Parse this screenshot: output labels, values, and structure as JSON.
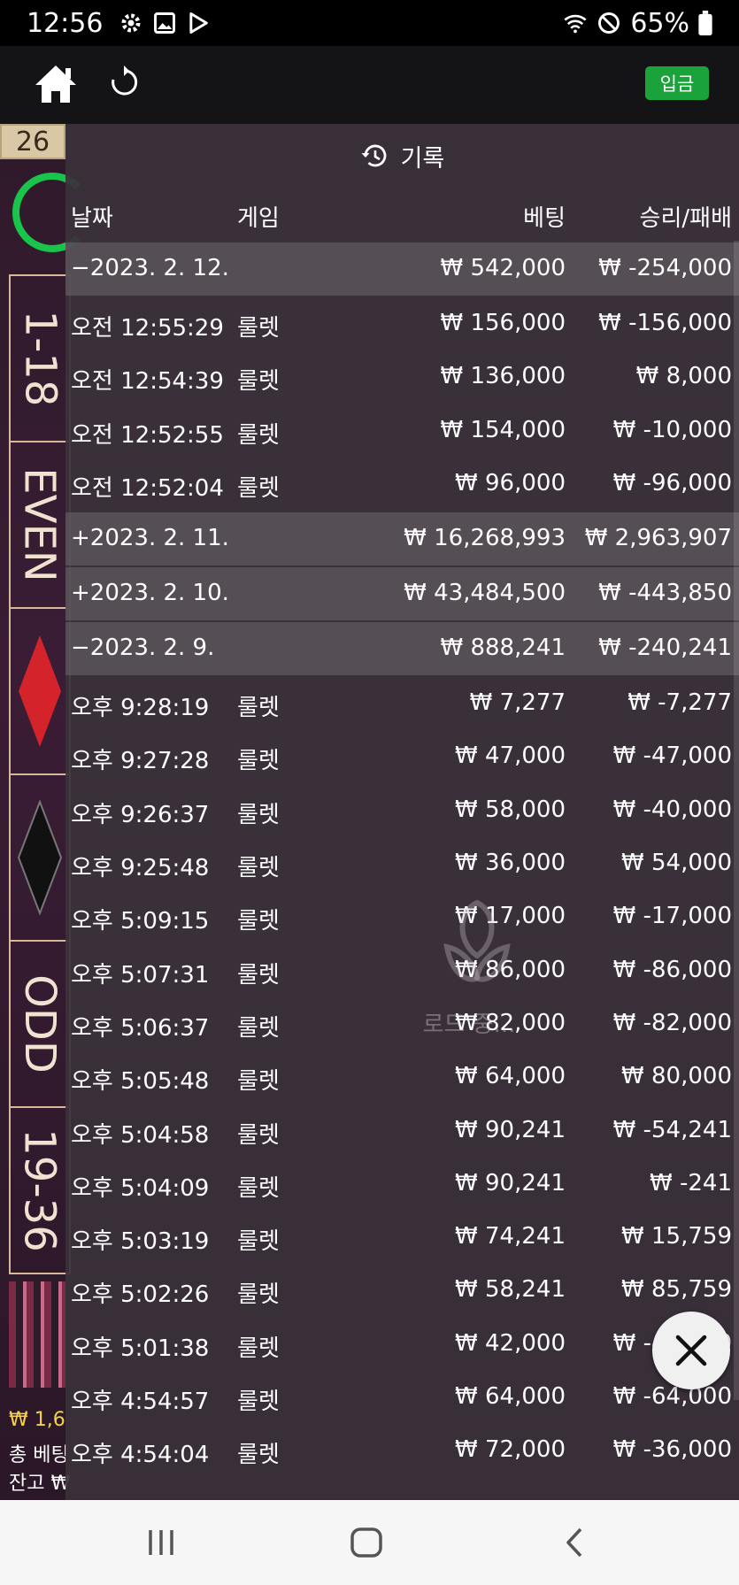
{
  "status_bar": {
    "time": "12:56",
    "battery": "65%"
  },
  "top_bar": {
    "deposit_label": "입금"
  },
  "background_game": {
    "round_number": "26",
    "bet_cells": [
      "1-18",
      "EVEN",
      "",
      "",
      "ODD",
      "19-36"
    ],
    "balance_amount": "₩ 1,6",
    "total_bet_label": "총 베팅",
    "balance_label": "잔고 ₩"
  },
  "history": {
    "title": "기록",
    "columns": {
      "date": "날짜",
      "game": "게임",
      "bet": "베팅",
      "win_loss": "승리/패배"
    },
    "rows": [
      {
        "type": "group",
        "date": "−2023. 2. 12.",
        "game": "",
        "bet": "₩ 542,000",
        "win": "₩ -254,000"
      },
      {
        "type": "item",
        "date": "오전 12:55:29",
        "game": "룰렛",
        "bet": "₩ 156,000",
        "win": "₩ -156,000"
      },
      {
        "type": "item",
        "date": "오전 12:54:39",
        "game": "룰렛",
        "bet": "₩ 136,000",
        "win": "₩ 8,000"
      },
      {
        "type": "item",
        "date": "오전 12:52:55",
        "game": "룰렛",
        "bet": "₩ 154,000",
        "win": "₩ -10,000"
      },
      {
        "type": "item",
        "date": "오전 12:52:04",
        "game": "룰렛",
        "bet": "₩ 96,000",
        "win": "₩ -96,000"
      },
      {
        "type": "group",
        "date": "+2023. 2. 11.",
        "game": "",
        "bet": "₩ 16,268,993",
        "win": "₩ 2,963,907"
      },
      {
        "type": "group",
        "date": "+2023. 2. 10.",
        "game": "",
        "bet": "₩ 43,484,500",
        "win": "₩ -443,850"
      },
      {
        "type": "group",
        "date": "−2023. 2. 9.",
        "game": "",
        "bet": "₩ 888,241",
        "win": "₩ -240,241"
      },
      {
        "type": "item",
        "date": "오후 9:28:19",
        "game": "룰렛",
        "bet": "₩ 7,277",
        "win": "₩ -7,277"
      },
      {
        "type": "item",
        "date": "오후 9:27:28",
        "game": "룰렛",
        "bet": "₩ 47,000",
        "win": "₩ -47,000"
      },
      {
        "type": "item",
        "date": "오후 9:26:37",
        "game": "룰렛",
        "bet": "₩ 58,000",
        "win": "₩ -40,000"
      },
      {
        "type": "item",
        "date": "오후 9:25:48",
        "game": "룰렛",
        "bet": "₩ 36,000",
        "win": "₩ 54,000"
      },
      {
        "type": "item",
        "date": "오후 5:09:15",
        "game": "룰렛",
        "bet": "₩ 17,000",
        "win": "₩ -17,000"
      },
      {
        "type": "item",
        "date": "오후 5:07:31",
        "game": "룰렛",
        "bet": "₩ 86,000",
        "win": "₩ -86,000"
      },
      {
        "type": "item",
        "date": "오후 5:06:37",
        "game": "룰렛",
        "bet": "₩ 82,000",
        "win": "₩ -82,000"
      },
      {
        "type": "item",
        "date": "오후 5:05:48",
        "game": "룰렛",
        "bet": "₩ 64,000",
        "win": "₩ 80,000"
      },
      {
        "type": "item",
        "date": "오후 5:04:58",
        "game": "룰렛",
        "bet": "₩ 90,241",
        "win": "₩ -54,241"
      },
      {
        "type": "item",
        "date": "오후 5:04:09",
        "game": "룰렛",
        "bet": "₩ 90,241",
        "win": "₩ -241"
      },
      {
        "type": "item",
        "date": "오후 5:03:19",
        "game": "룰렛",
        "bet": "₩ 74,241",
        "win": "₩ 15,759"
      },
      {
        "type": "item",
        "date": "오후 5:02:26",
        "game": "룰렛",
        "bet": "₩ 58,241",
        "win": "₩ 85,759"
      },
      {
        "type": "item",
        "date": "오후 5:01:38",
        "game": "룰렛",
        "bet": "₩ 42,000",
        "win": "₩ -42,000"
      },
      {
        "type": "item",
        "date": "오후 4:54:57",
        "game": "룰렛",
        "bet": "₩ 64,000",
        "win": "₩ -64,000"
      },
      {
        "type": "item",
        "date": "오후 4:54:04",
        "game": "룰렛",
        "bet": "₩ 72,000",
        "win": "₩ -36,000"
      }
    ]
  },
  "loading": {
    "text": "로드 중..."
  },
  "colors": {
    "deposit_green": "#1aa33a",
    "timer_green": "#19c44a",
    "balance_yellow": "#f3d24a"
  },
  "icons": [
    "settings-icon",
    "image-icon",
    "play-store-icon",
    "wifi-icon",
    "do-not-disturb-icon",
    "battery-icon",
    "home-icon",
    "refresh-icon",
    "history-icon",
    "close-icon",
    "recents-icon",
    "nav-home-icon",
    "back-icon"
  ]
}
